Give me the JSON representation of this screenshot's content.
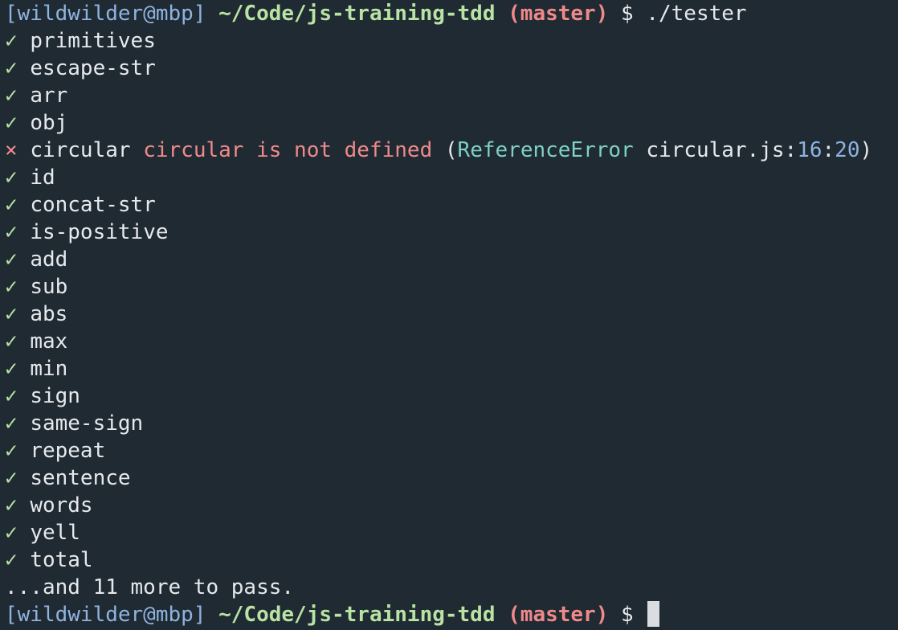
{
  "prompt": {
    "user_host": "[wildwilder@mbp]",
    "path": "~/Code/js-training-tdd",
    "branch": "(master)",
    "symbol": "$",
    "command": "./tester"
  },
  "results": {
    "pass_symbol": "✓",
    "fail_symbol": "×",
    "before_fail": [
      "primitives",
      "escape-str",
      "arr",
      "obj"
    ],
    "failed": {
      "name": "circular",
      "message": "circular is not defined",
      "open_paren": "(",
      "error_type": "ReferenceError",
      "file": "circular.js",
      "sep1": ":",
      "line": "16",
      "sep2": ":",
      "column": "20",
      "close_paren": ")"
    },
    "after_fail": [
      "id",
      "concat-str",
      "is-positive",
      "add",
      "sub",
      "abs",
      "max",
      "min",
      "sign",
      "same-sign",
      "repeat",
      "sentence",
      "words",
      "yell",
      "total"
    ]
  },
  "summary": "...and 11 more to pass.",
  "colors": {
    "background": "#1f2a33",
    "foreground": "#e6e9ec",
    "user": "#8fb3df",
    "path": "#b9e3a4",
    "branch": "#f08a8a",
    "pass": "#b9e3a4",
    "fail": "#f08a8a",
    "error_type": "#7fd0c5",
    "number": "#8fb3df"
  }
}
